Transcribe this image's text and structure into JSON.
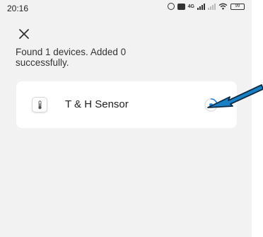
{
  "status_bar": {
    "time": "20:16",
    "network_label": "4G",
    "battery_level": "99"
  },
  "header": {
    "close_icon": "close-icon"
  },
  "summary": {
    "text": "Found 1 devices. Added 0 successfully."
  },
  "device": {
    "name": "T & H Sensor",
    "icon": "thermometer-icon",
    "status": "adding-in-progress"
  },
  "colors": {
    "background": "#f2f2f2",
    "card": "#ffffff",
    "accent": "#1e7fd8",
    "annotation_arrow": "#1a7fc4"
  }
}
